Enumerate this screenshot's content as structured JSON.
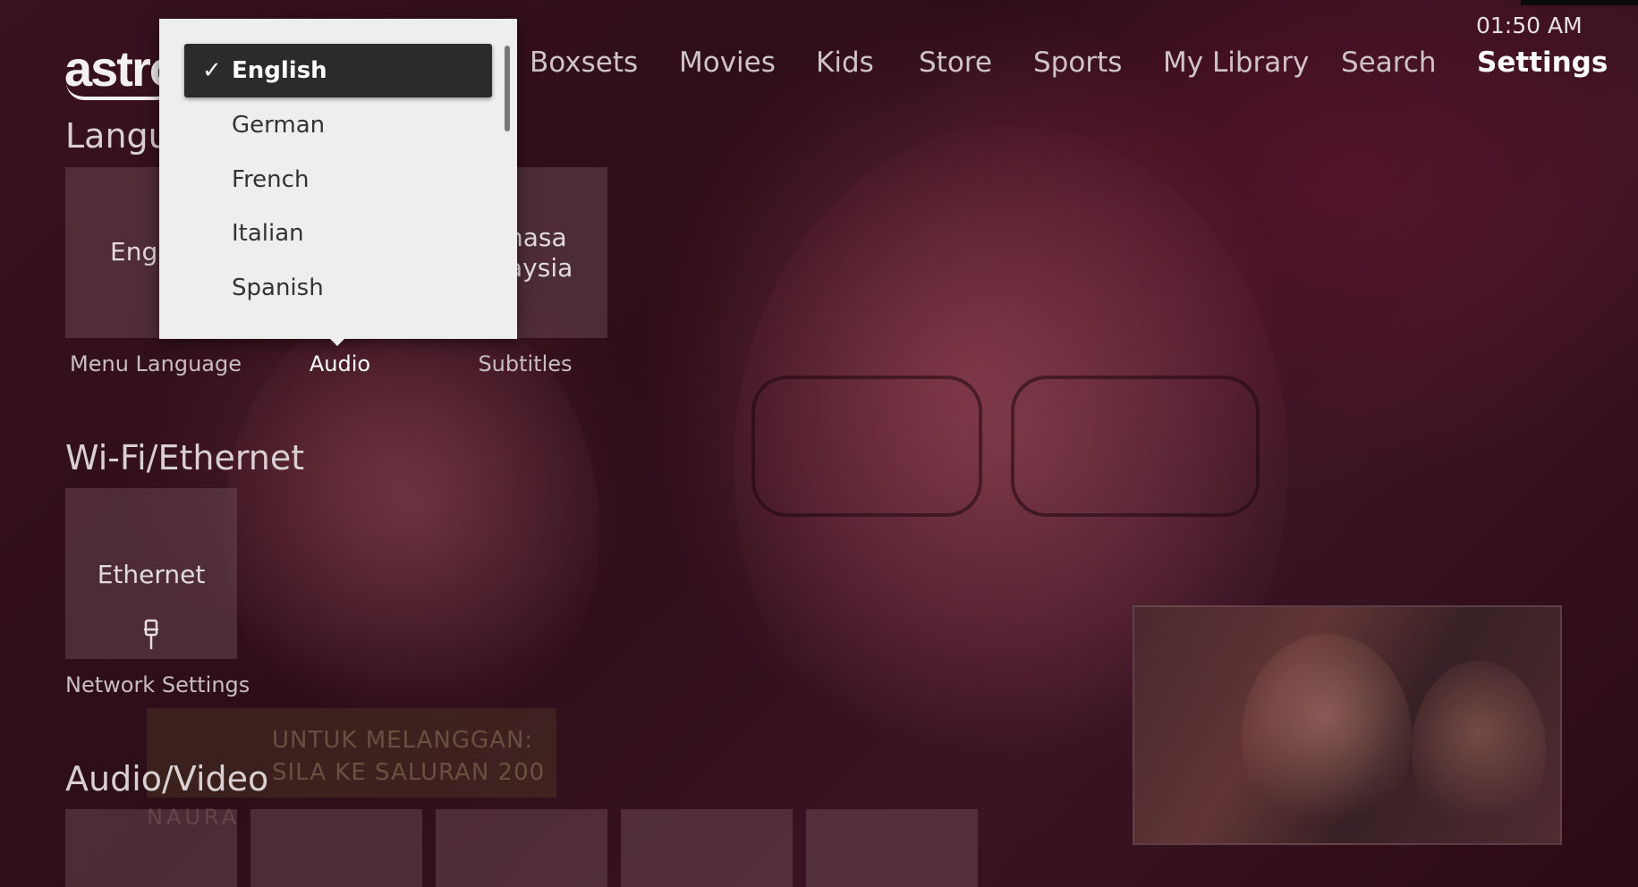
{
  "brand": {
    "logo_text": "astro"
  },
  "clock": "01:50 AM",
  "nav": {
    "items": [
      {
        "label": "Boxsets"
      },
      {
        "label": "Movies"
      },
      {
        "label": "Kids"
      },
      {
        "label": "Store"
      },
      {
        "label": "Sports"
      },
      {
        "label": "My Library"
      },
      {
        "label": "Search"
      },
      {
        "label": "Settings",
        "active": true
      }
    ]
  },
  "language": {
    "title": "Langu",
    "tiles": [
      {
        "value": "Engl",
        "caption": "Menu Language"
      },
      {
        "value": "",
        "caption": "Audio"
      },
      {
        "value_line1": "nasa",
        "value_line2": "aysia",
        "caption": "Subtitles"
      }
    ]
  },
  "dropdown": {
    "selected": "English",
    "options": [
      "English",
      "German",
      "French",
      "Italian",
      "Spanish"
    ],
    "check_icon": "checkmark-icon"
  },
  "network": {
    "title": "Wi-Fi/Ethernet",
    "tile_label": "Ethernet",
    "icon": "ethernet-plug-icon",
    "caption": "Network Settings"
  },
  "audio_video": {
    "title": "Audio/Video",
    "tile_count_visible": 5
  },
  "promo": {
    "line1": "UNTUK MELANGGAN:",
    "line2": "SILA KE SALURAN 200",
    "tag": "NAURA"
  },
  "colors": {
    "background": "#2a0f18",
    "dropdown_bg": "#eeeeee",
    "selected_option_bg": "#2b2b2b",
    "active_nav": "#ffffff"
  }
}
